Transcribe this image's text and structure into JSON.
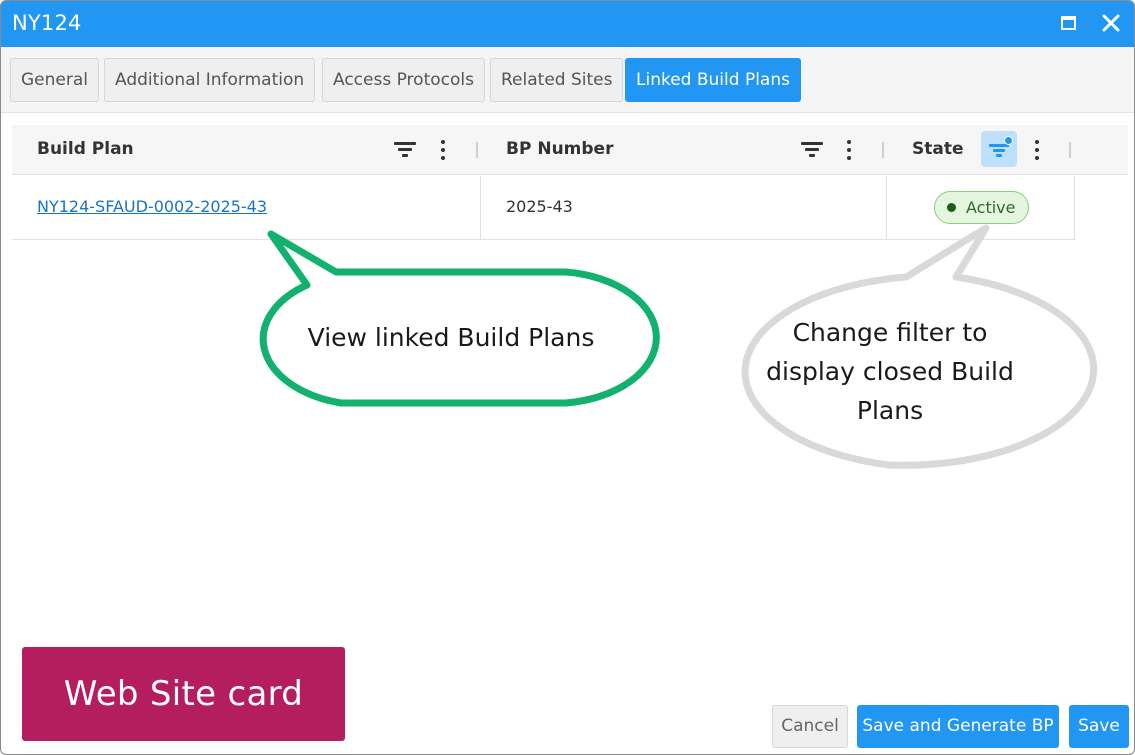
{
  "window": {
    "title": "NY124"
  },
  "tabs": [
    {
      "label": "General",
      "active": false
    },
    {
      "label": "Additional Information",
      "active": false
    },
    {
      "label": "Access Protocols",
      "active": false
    },
    {
      "label": "Related Sites",
      "active": false
    },
    {
      "label": "Linked Build Plans",
      "active": true
    }
  ],
  "grid": {
    "columns": [
      {
        "title": "Build Plan"
      },
      {
        "title": "BP Number"
      },
      {
        "title": "State",
        "filter_active": true
      }
    ],
    "rows": [
      {
        "build_plan": "NY124-SFAUD-0002-2025-43",
        "bp_number": "2025-43",
        "state": "Active"
      }
    ]
  },
  "callouts": {
    "green": {
      "text": "View linked Build Plans",
      "color": "#12b26e"
    },
    "gray": {
      "line1": "Change filter to",
      "line2": "display closed Build",
      "line3": "Plans",
      "color": "#d9d9d9"
    }
  },
  "brand_label": "Web Site card",
  "buttons": {
    "cancel": "Cancel",
    "save_generate": "Save and Generate BP",
    "save": "Save"
  },
  "colors": {
    "primary": "#2196f3",
    "brand": "#b51e5e",
    "active_badge_bg": "#e4f6e0",
    "link": "#1a73c8"
  }
}
